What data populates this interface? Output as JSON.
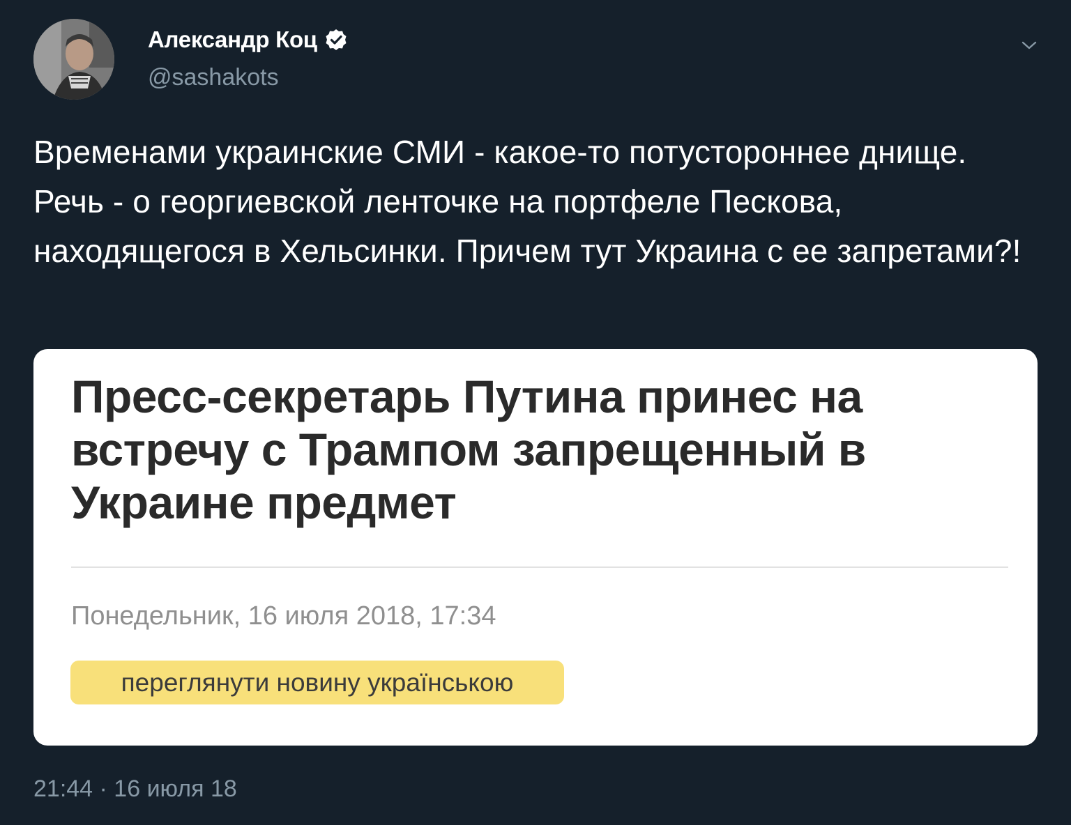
{
  "author": {
    "display_name": "Александр Коц",
    "handle": "@sashakots"
  },
  "tweet": {
    "text": "Временами украинские СМИ - какое-то потустороннее днище. Речь - о георгиевской ленточке на портфеле Пескова, находящегося в Хельсинки. Причем тут Украина с ее запретами?!",
    "timestamp": "21:44 · 16 июля 18"
  },
  "embed": {
    "headline": "Пресс-секретарь Путина принес на встречу с Трампом запрещенный в Украине предмет",
    "date": "Понедельник, 16 июля 2018, 17:34",
    "button_label": "переглянути новину українською"
  },
  "icons": {
    "verified": "verified-badge-icon",
    "menu": "chevron-down-icon"
  },
  "colors": {
    "background": "#15202b",
    "secondary_text": "#8899a6",
    "pill": "#f8e07a"
  }
}
